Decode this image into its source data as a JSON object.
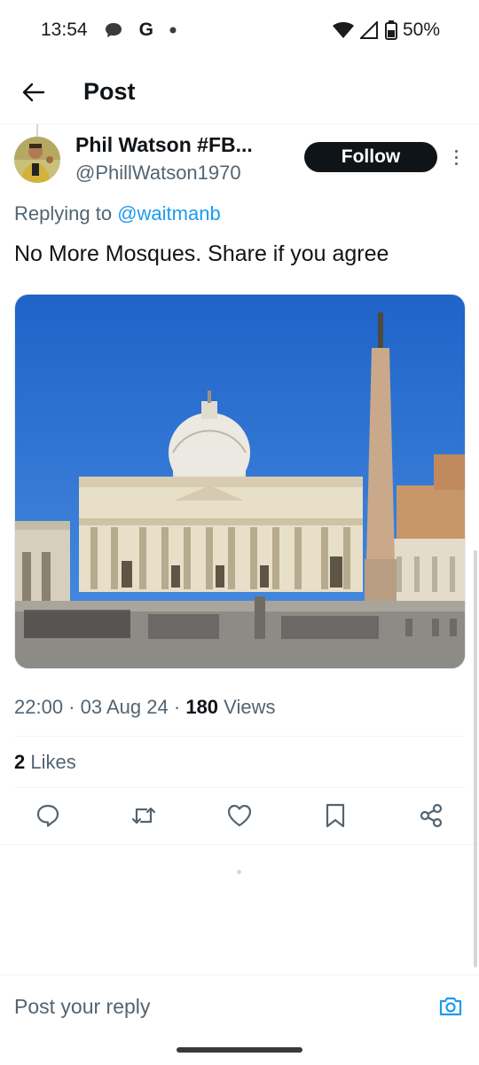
{
  "status_bar": {
    "time": "13:54",
    "google_letter": "G",
    "battery": "50%"
  },
  "header": {
    "title": "Post"
  },
  "post": {
    "author_name": "Phil Watson #FB...",
    "author_handle": "@PhillWatson1970",
    "follow_label": "Follow",
    "replying_prefix": "Replying to",
    "replying_to": "@waitmanb",
    "text": "No More Mosques. Share if you agree",
    "time": "22:00",
    "date": "03 Aug 24",
    "views_count": "180",
    "views_label": "Views",
    "likes_count": "2",
    "likes_label": "Likes"
  },
  "actions": {
    "icons": [
      "reply-icon",
      "repost-icon",
      "like-icon",
      "bookmark-icon",
      "share-icon"
    ]
  },
  "reply_bar": {
    "placeholder": "Post your reply"
  },
  "colors": {
    "accent": "#1d9bf0",
    "text_primary": "#0f1419",
    "text_secondary": "#536471"
  }
}
